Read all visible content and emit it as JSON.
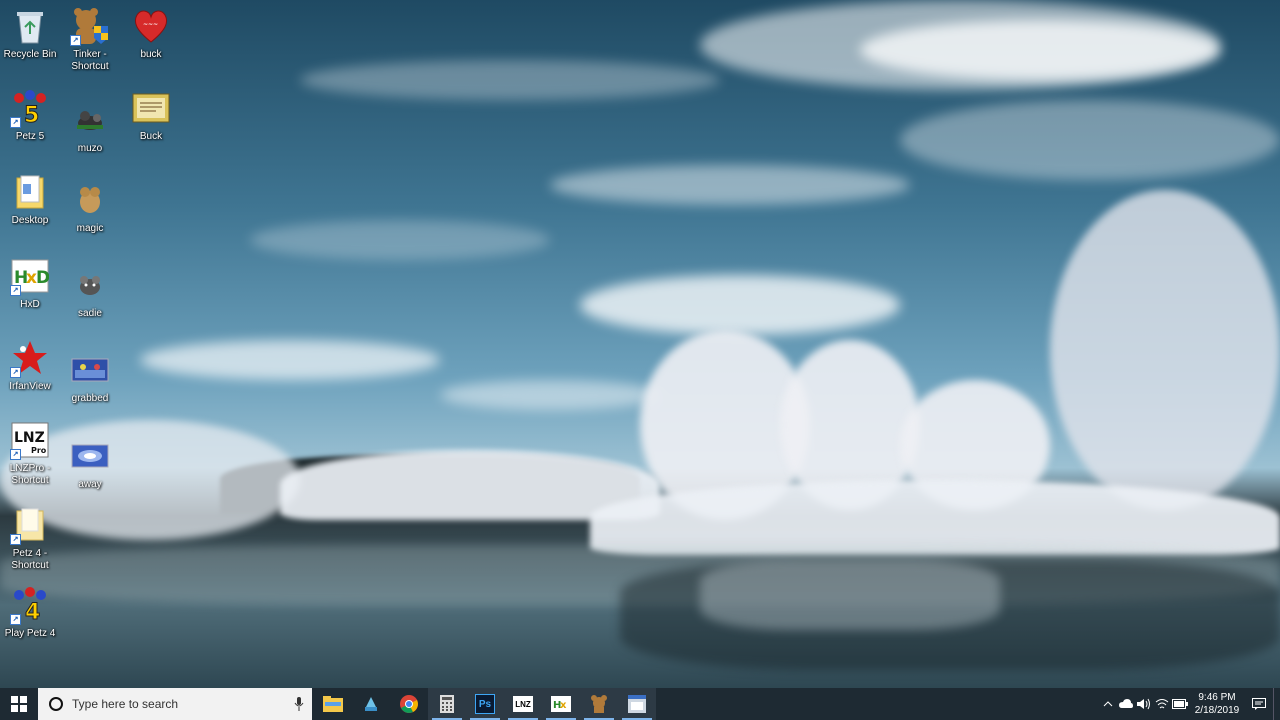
{
  "desktop_icons": [
    {
      "label": "Recycle Bin",
      "icon": "recycle-bin-icon"
    },
    {
      "label": "Tinker -\nShortcut",
      "icon": "tinker-shortcut-icon"
    },
    {
      "label": "buck",
      "icon": "heart-icon"
    },
    {
      "label": "Petz 5",
      "icon": "petz5-icon"
    },
    {
      "label": "muzo",
      "icon": "muzo-icon"
    },
    {
      "label": "Buck",
      "icon": "buck-image-icon"
    },
    {
      "label": "Desktop",
      "icon": "folder-icon"
    },
    {
      "label": "magic",
      "icon": "magic-icon"
    },
    {
      "label": "HxD",
      "icon": "hxd-icon"
    },
    {
      "label": "sadie",
      "icon": "sadie-icon"
    },
    {
      "label": "IrfanView",
      "icon": "irfanview-icon"
    },
    {
      "label": "grabbed",
      "icon": "grabbed-icon"
    },
    {
      "label": "LNZPro -\nShortcut",
      "icon": "lnzpro-icon"
    },
    {
      "label": "away",
      "icon": "away-icon"
    },
    {
      "label": "Petz 4 -\nShortcut",
      "icon": "folder-shortcut-icon"
    },
    {
      "label": "Play Petz 4",
      "icon": "petz4-icon"
    }
  ],
  "taskbar": {
    "search_placeholder": "Type here to search",
    "apps": [
      "file-explorer-icon",
      "app-icon",
      "chrome-icon",
      "calculator-icon",
      "photoshop-icon",
      "lnz-icon",
      "hxd-icon",
      "petz-icon",
      "app-window-icon"
    ],
    "ps_label": "Ps",
    "lnz_label": "LNZ",
    "clock_time": "9:46 PM",
    "clock_date": "2/18/2019"
  },
  "colors": {
    "taskbar": "#1e2a33",
    "accent": "#7eb4ea"
  }
}
